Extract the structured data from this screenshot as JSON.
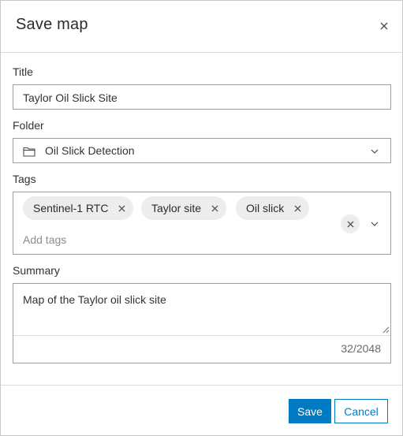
{
  "dialog": {
    "title": "Save map",
    "close_icon": "close-icon"
  },
  "fields": {
    "title": {
      "label": "Title",
      "value": "Taylor Oil Slick Site"
    },
    "folder": {
      "label": "Folder",
      "value": "Oil Slick Detection",
      "icon": "folder-icon"
    },
    "tags": {
      "label": "Tags",
      "chips": [
        "Sentinel-1 RTC",
        "Taylor site",
        "Oil slick"
      ],
      "placeholder": "Add tags"
    },
    "summary": {
      "label": "Summary",
      "value": "Map of the Taylor oil slick site",
      "char_count": "32/2048"
    }
  },
  "buttons": {
    "save": "Save",
    "cancel": "Cancel"
  },
  "colors": {
    "accent": "#007ac2",
    "chip_bg": "#ededed",
    "border": "#9f9f9f"
  }
}
